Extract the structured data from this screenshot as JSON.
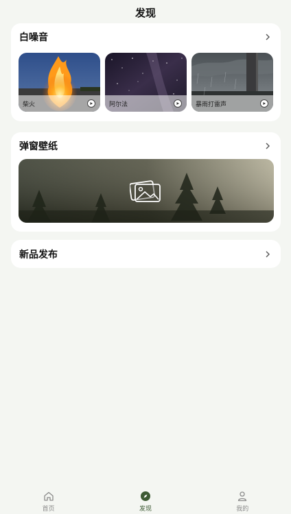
{
  "header": {
    "title": "发现"
  },
  "noise_section": {
    "title": "白噪音",
    "items": [
      {
        "label": "柴火",
        "icon": "play-icon"
      },
      {
        "label": "阿尔法",
        "icon": "play-icon"
      },
      {
        "label": "暴雨打雷声",
        "icon": "play-icon"
      }
    ]
  },
  "wallpaper_section": {
    "title": "弹窗壁纸",
    "icon": "image-gallery-icon"
  },
  "new_section": {
    "title": "新品发布"
  },
  "tabbar": {
    "items": [
      {
        "label": "首页",
        "icon": "home-icon"
      },
      {
        "label": "发现",
        "icon": "compass-icon"
      },
      {
        "label": "我的",
        "icon": "user-icon"
      }
    ],
    "active": "发现"
  },
  "colors": {
    "accent": "#3d5a34",
    "background": "#f4f6f2",
    "card": "#ffffff"
  }
}
